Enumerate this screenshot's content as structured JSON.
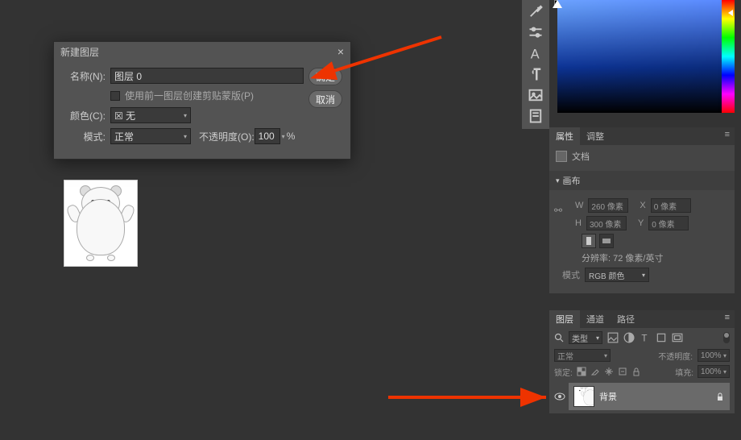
{
  "dialog": {
    "title": "新建图层",
    "name_label": "名称(N):",
    "name_value": "图层 0",
    "clip_checkbox_label": "使用前一图层创建剪贴蒙版(P)",
    "color_label": "颜色(C):",
    "color_value": "无",
    "color_swatch": "☒",
    "mode_label": "模式:",
    "mode_value": "正常",
    "opacity_label": "不透明度(O):",
    "opacity_value": "100",
    "opacity_suffix": "%",
    "ok": "确定",
    "cancel": "取消"
  },
  "properties": {
    "tab_properties": "属性",
    "tab_adjust": "调整",
    "doc_label": "文档",
    "canvas_header": "画布",
    "w_label": "W",
    "w_value": "260 像素",
    "h_label": "H",
    "h_value": "300 像素",
    "x_label": "X",
    "x_value": "0 像素",
    "y_label": "Y",
    "y_value": "0 像素",
    "resolution": "分辨率: 72 像素/英寸",
    "mode_label": "模式",
    "mode_value": "RGB 颜色"
  },
  "layers": {
    "tab_layers": "图层",
    "tab_channels": "通道",
    "tab_paths": "路径",
    "kind": "类型",
    "blend_mode": "正常",
    "opacity_label": "不透明度:",
    "opacity_value": "100%",
    "lock_label": "锁定:",
    "fill_label": "填充:",
    "fill_value": "100%",
    "layer_name": "背景"
  }
}
